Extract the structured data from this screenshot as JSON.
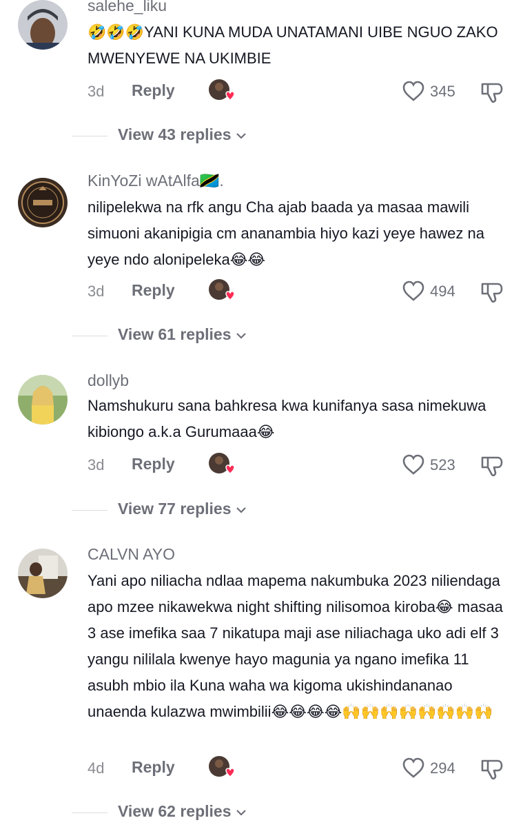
{
  "comments": [
    {
      "username": "salehe_liku",
      "text": "🤣🤣🤣YANI KUNA MUDA UNATAMANI UIBE NGUO ZAKO MWENYEWE NA UKIMBIE",
      "age": "3d",
      "reply_label": "Reply",
      "likes": "345",
      "view_replies": "View 43 replies"
    },
    {
      "username": "KinYoZi wAtAlfa🇹🇿.",
      "text": "nilipelekwa na rfk angu Cha ajab baada ya masaa mawili simuoni akanipigia cm ananambia hiyo kazi yeye hawez na yeye ndo alonipeleka😂😂",
      "age": "3d",
      "reply_label": "Reply",
      "likes": "494",
      "view_replies": "View 61 replies"
    },
    {
      "username": "dollyb",
      "text": "Namshukuru sana bahkresa kwa kunifanya sasa nimekuwa kibiongo a.k.a Gurumaaa😂",
      "age": "3d",
      "reply_label": "Reply",
      "likes": "523",
      "view_replies": "View 77 replies"
    },
    {
      "username": "CALVN AYO",
      "text": "Yani apo niliacha ndlaa mapema nakumbuka 2023 niliendaga apo mzee nikawekwa night shifting nilisomoa kiroba😂 masaa 3 ase imefika saa 7 nikatupa maji ase niliachaga uko adi elf 3 yangu nililala kwenye hayo magunia ya ngano imefika 11 asubh mbio ila Kuna waha wa kigoma ukishindananao unaenda kulazwa mwimbilii😂😂😂😂🙌🙌🙌🙌🙌🙌🙌🙌",
      "age": "4d",
      "reply_label": "Reply",
      "likes": "294",
      "view_replies": "View 62 replies"
    }
  ],
  "icons": {
    "like": "heart-outline-icon",
    "dislike": "thumbs-down-icon",
    "creator_liked": "creator-liked-heart-icon",
    "expand": "chevron-down-icon"
  },
  "colors": {
    "text": "#161823",
    "secondary": "#6d6f78",
    "creator_heart": "#fe2c55"
  }
}
